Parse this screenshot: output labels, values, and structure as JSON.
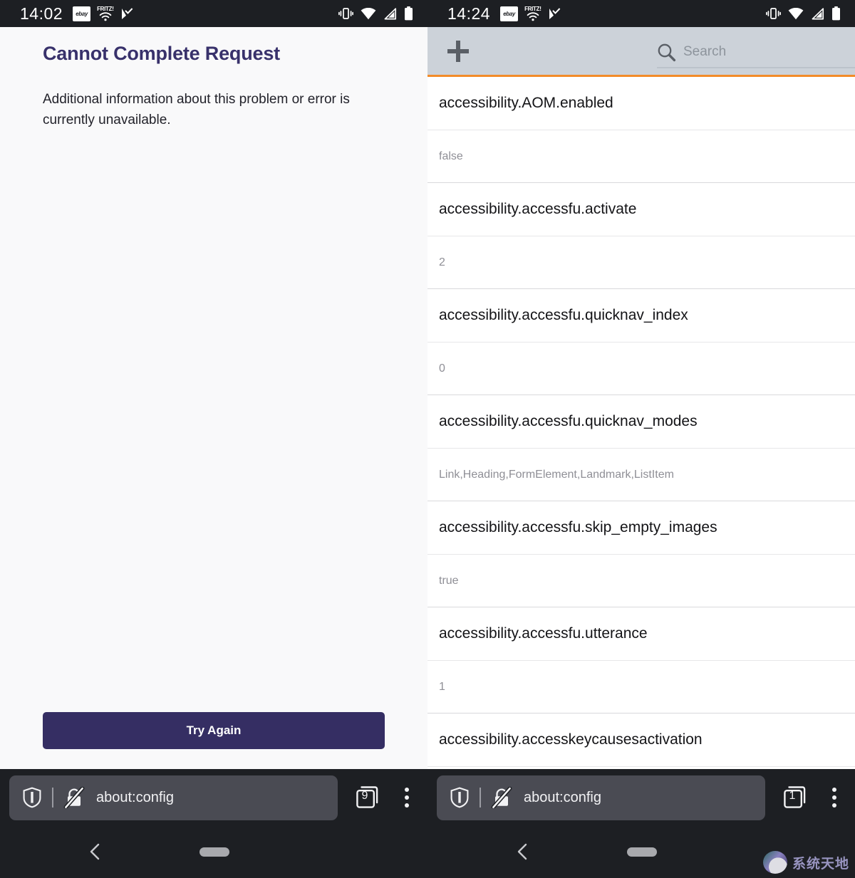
{
  "left_device": {
    "status_bar": {
      "clock": "14:02",
      "icons": [
        "ebay-icon",
        "fritz-wifi-icon",
        "tasks-check-icon"
      ],
      "right_icons": [
        "vibrate-icon",
        "wifi-icon",
        "cellular-signal-icon",
        "battery-icon"
      ],
      "ebay_label": "ebay",
      "fritz_label": "FRITZ!"
    },
    "error_page": {
      "title": "Cannot Complete Request",
      "body": "Additional information about this problem or error is currently unavailable.",
      "button_label": "Try Again"
    },
    "browser_bar": {
      "url": "about:config",
      "tab_count": "9",
      "shield_icon": "tracking-protection-shield-icon",
      "lock_icon": "insecure-connection-slashed-lock-icon",
      "tabs_icon": "tab-counter-icon",
      "menu_icon": "three-dot-menu-icon"
    },
    "nav_bar": {
      "back_icon": "back-chevron-icon",
      "home_pill": "home-gesture-pill"
    }
  },
  "right_device": {
    "status_bar": {
      "clock": "14:24",
      "icons": [
        "ebay-icon",
        "fritz-wifi-icon",
        "tasks-check-icon"
      ],
      "right_icons": [
        "vibrate-icon",
        "wifi-icon",
        "cellular-signal-icon",
        "battery-icon"
      ],
      "ebay_label": "ebay",
      "fritz_label": "FRITZ!"
    },
    "config_page": {
      "toolbar": {
        "add_icon": "plus-icon",
        "search_icon": "search-icon",
        "search_value": "",
        "search_placeholder": "Search",
        "accent_color": "#f38b29"
      },
      "preferences": [
        {
          "name": "accessibility.AOM.enabled",
          "value": "false"
        },
        {
          "name": "accessibility.accessfu.activate",
          "value": "2"
        },
        {
          "name": "accessibility.accessfu.quicknav_index",
          "value": "0"
        },
        {
          "name": "accessibility.accessfu.quicknav_modes",
          "value": "Link,Heading,FormElement,Landmark,ListItem"
        },
        {
          "name": "accessibility.accessfu.skip_empty_images",
          "value": "true"
        },
        {
          "name": "accessibility.accessfu.utterance",
          "value": "1"
        },
        {
          "name": "accessibility.accesskeycausesactivation",
          "value": ""
        }
      ]
    },
    "browser_bar": {
      "url": "about:config",
      "tab_count": "1",
      "shield_icon": "tracking-protection-shield-icon",
      "lock_icon": "insecure-connection-slashed-lock-icon",
      "tabs_icon": "tab-counter-icon",
      "menu_icon": "three-dot-menu-icon"
    },
    "nav_bar": {
      "back_icon": "back-chevron-icon",
      "home_pill": "home-gesture-pill"
    }
  },
  "watermark": {
    "text": "系统天地"
  },
  "colors": {
    "error_title": "#38316b",
    "button": "#352e63",
    "config_toolbar": "#ccd2d9",
    "config_accent": "#f38b29",
    "page_background": "#f9f9fa",
    "chrome_dark": "#1d1f23"
  }
}
